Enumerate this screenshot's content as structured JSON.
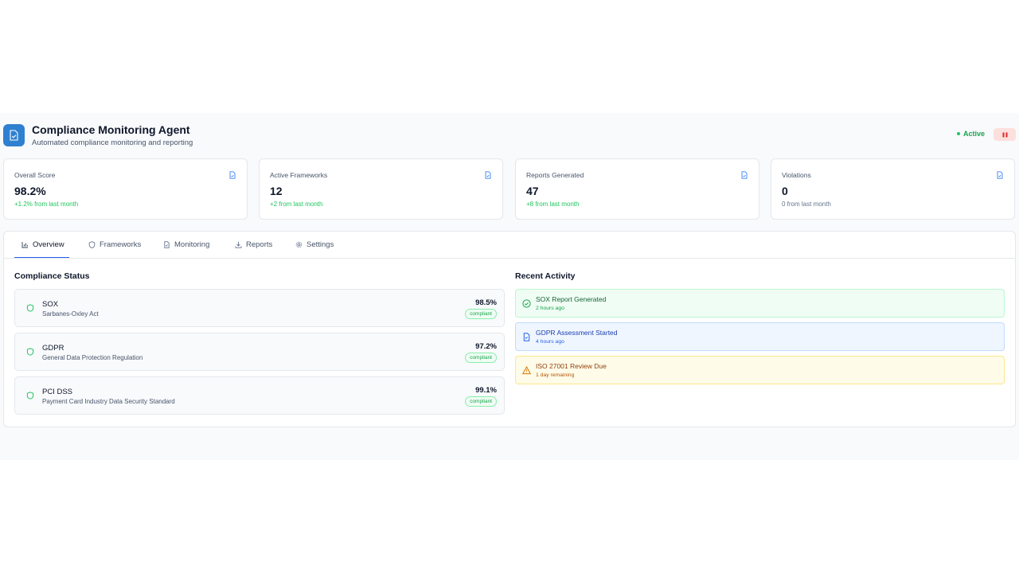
{
  "header": {
    "title": "Compliance Monitoring Agent",
    "subtitle": "Automated compliance monitoring and reporting",
    "status": "Active"
  },
  "stats": [
    {
      "label": "Overall Score",
      "value": "98.2%",
      "change": "+1.2% from last month",
      "change_color": "#22c55e"
    },
    {
      "label": "Active Frameworks",
      "value": "12",
      "change": "+2 from last month",
      "change_color": "#22c55e"
    },
    {
      "label": "Reports Generated",
      "value": "47",
      "change": "+8 from last month",
      "change_color": "#22c55e"
    },
    {
      "label": "Violations",
      "value": "0",
      "change": "0 from last month",
      "change_color": "#64748b"
    }
  ],
  "tabs": [
    {
      "label": "Overview",
      "icon": "bar-chart-icon"
    },
    {
      "label": "Frameworks",
      "icon": "shield-icon"
    },
    {
      "label": "Monitoring",
      "icon": "file-icon"
    },
    {
      "label": "Reports",
      "icon": "download-icon"
    },
    {
      "label": "Settings",
      "icon": "gear-icon"
    }
  ],
  "compliance": {
    "title": "Compliance Status",
    "frameworks": [
      {
        "name": "SOX",
        "desc": "Sarbanes-Oxley Act",
        "score": "98.5%",
        "status": "compliant"
      },
      {
        "name": "GDPR",
        "desc": "General Data Protection Regulation",
        "score": "97.2%",
        "status": "compliant"
      },
      {
        "name": "PCI DSS",
        "desc": "Payment Card Industry Data Security Standard",
        "score": "99.1%",
        "status": "compliant"
      }
    ]
  },
  "activity": {
    "title": "Recent Activity",
    "items": [
      {
        "title": "SOX Report Generated",
        "time": "2 hours ago",
        "icon": "check-circle-icon"
      },
      {
        "title": "GDPR Assessment Started",
        "time": "4 hours ago",
        "icon": "file-icon"
      },
      {
        "title": "ISO 27001 Review Due",
        "time": "1 day remaining",
        "icon": "warning-icon"
      }
    ]
  },
  "colors": {
    "accent": "#2f80d0",
    "success": "#22c55e",
    "info": "#2563eb",
    "warning": "#d97706"
  }
}
